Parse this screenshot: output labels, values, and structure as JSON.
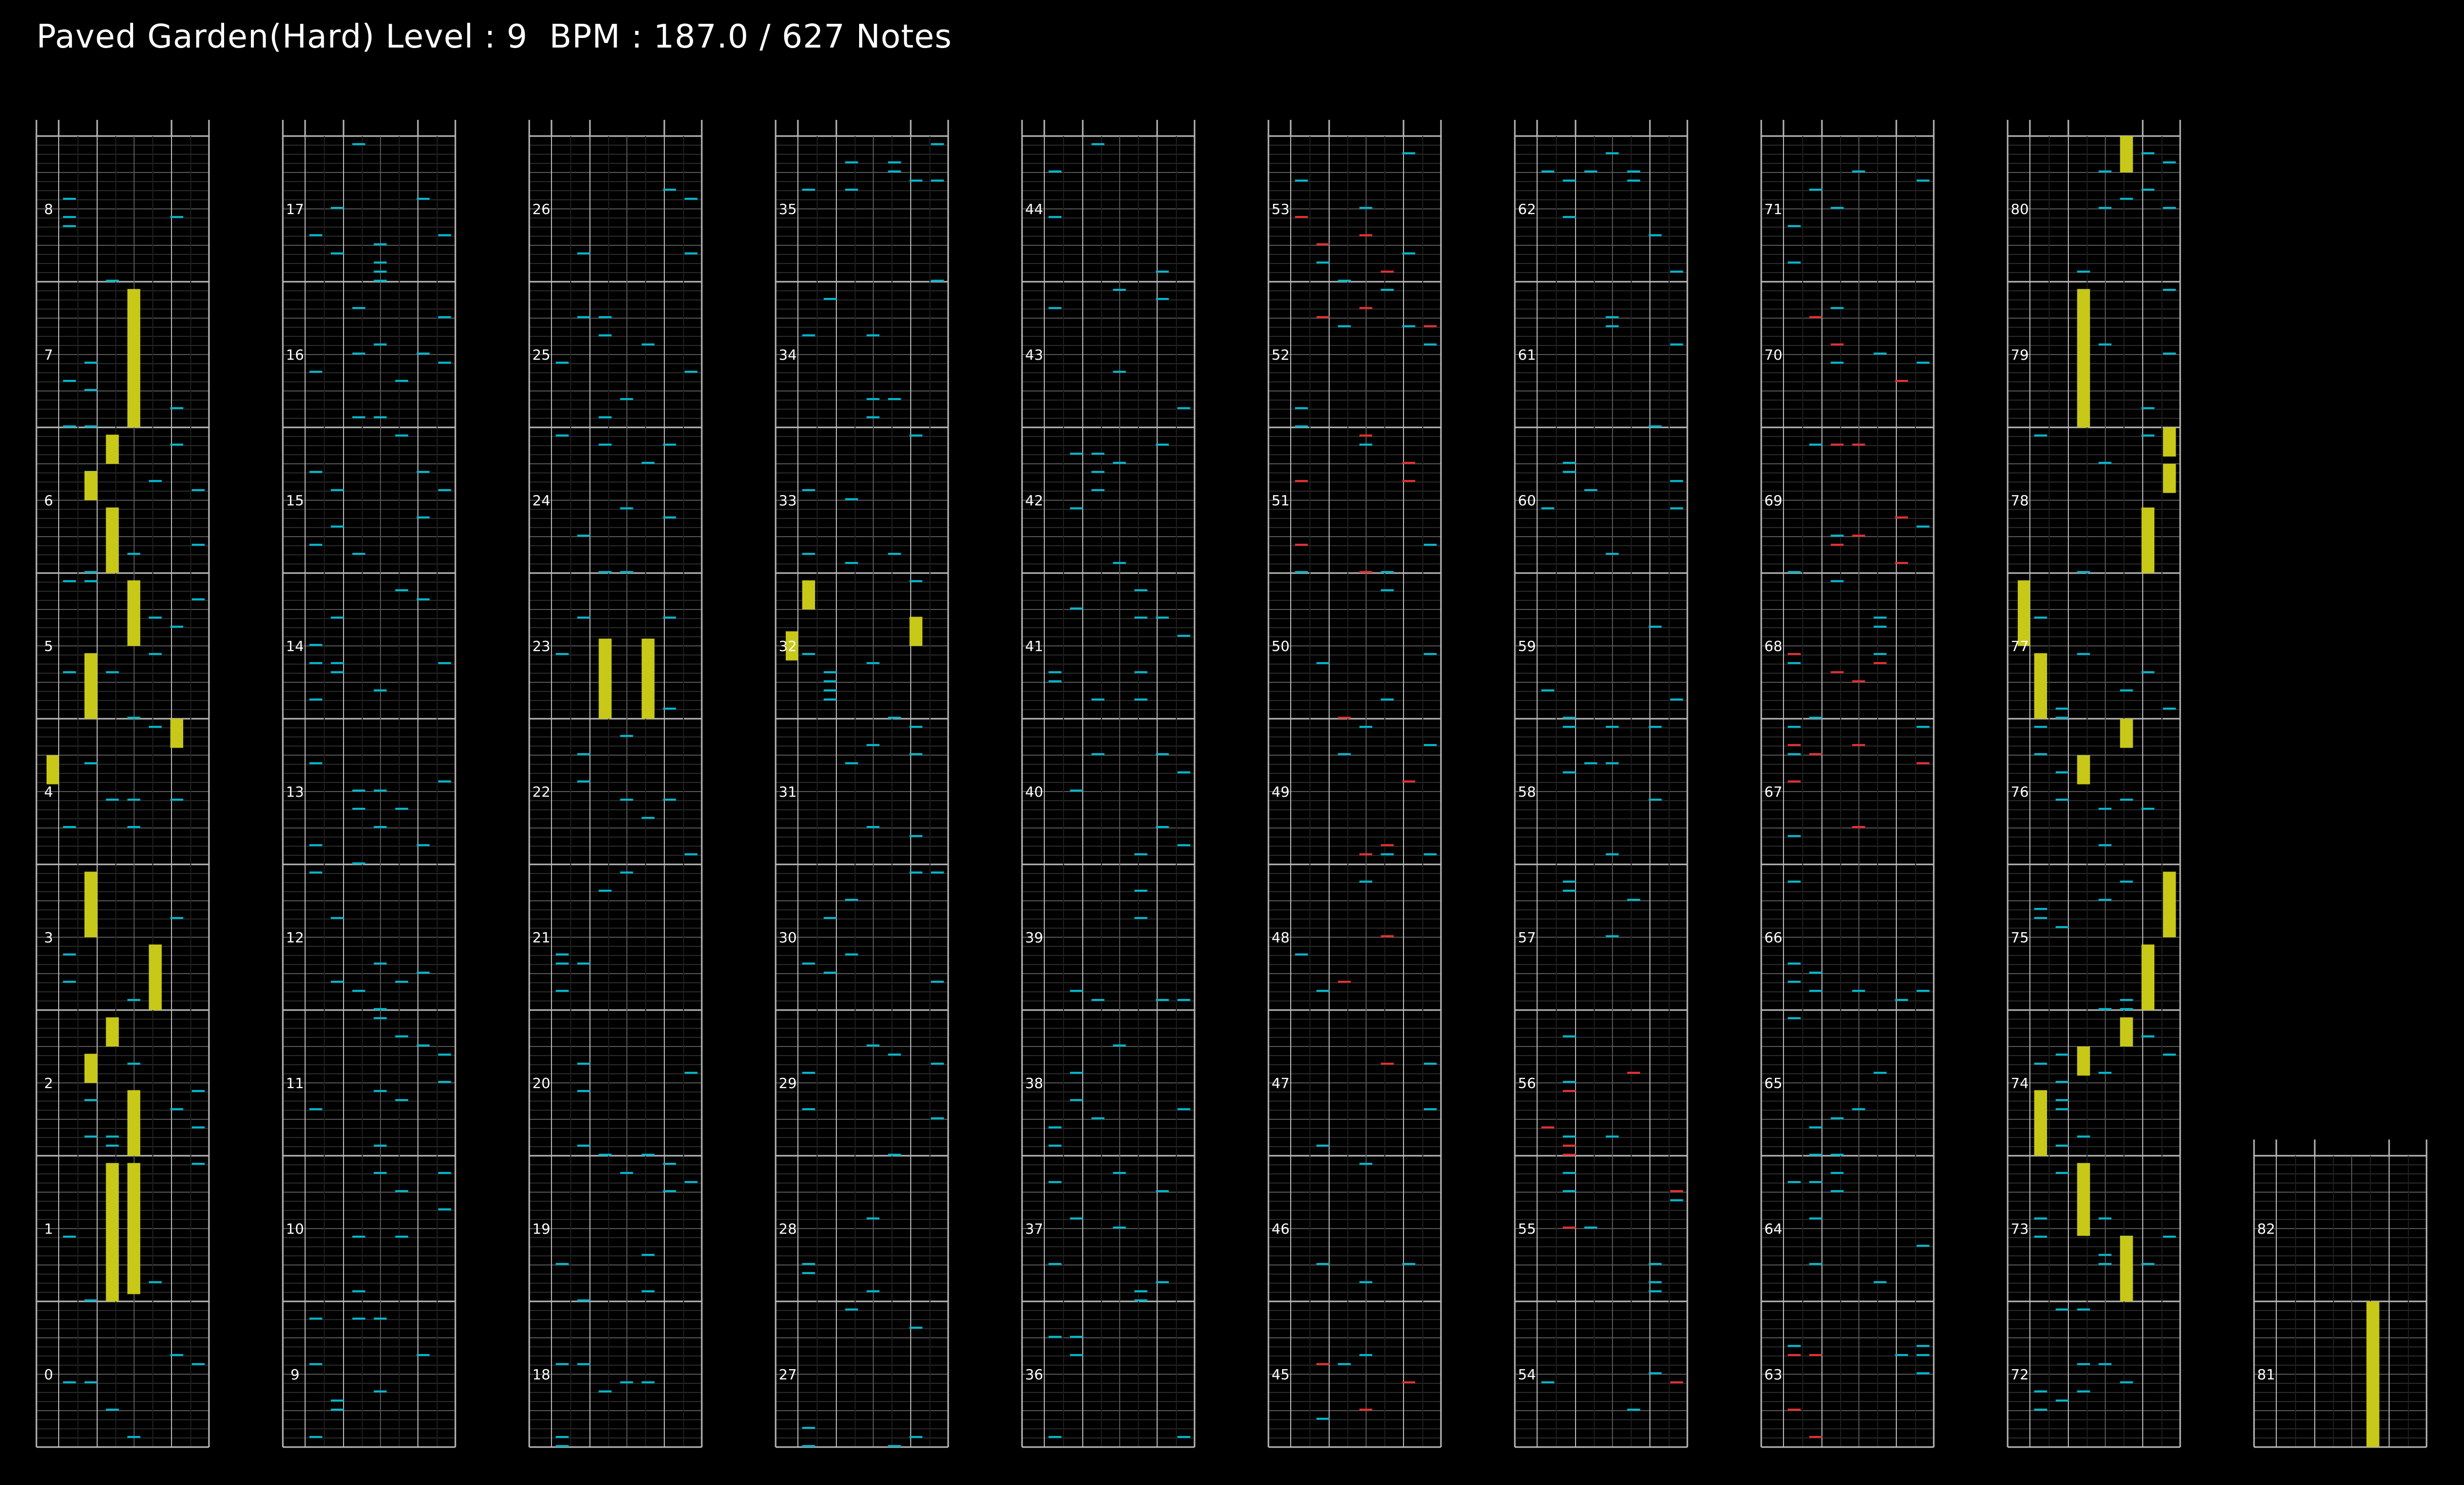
{
  "header": {
    "title": "Paved Garden(Hard) Level : 9  BPM : 187.0 / 627 Notes"
  },
  "chart_data": {
    "type": "rhythm-chart",
    "song": "Paved Garden",
    "difficulty": "Hard",
    "level": 9,
    "bpm": 187.0,
    "notes": 627,
    "measures_per_column": 9,
    "total_measures": 83,
    "lanes": 8,
    "colors": {
      "background": "#000000",
      "measure_line": "#b8b8b8",
      "beat_line": "#555555",
      "grid_line": "#2a2a2a",
      "tap_note": "#00b4c8",
      "alt_note": "#e03030",
      "long_note": "#c8c819",
      "text": "#ffffff"
    },
    "long_notes": [
      {
        "measure": 1,
        "lane": 5,
        "start": 0.05,
        "end": 0.95
      },
      {
        "measure": 1,
        "lane": 4,
        "start": 0.0,
        "end": 0.95
      },
      {
        "measure": 2,
        "lane": 4,
        "start": 0.75,
        "end": 0.95
      },
      {
        "measure": 2,
        "lane": 3,
        "start": 0.5,
        "end": 0.7
      },
      {
        "measure": 2,
        "lane": 5,
        "start": 0.0,
        "end": 0.45
      },
      {
        "measure": 3,
        "lane": 3,
        "start": 0.5,
        "end": 0.95
      },
      {
        "measure": 3,
        "lane": 6,
        "start": 0.0,
        "end": 0.45
      },
      {
        "measure": 4,
        "lane": 1,
        "start": 0.55,
        "end": 0.75
      },
      {
        "measure": 4,
        "lane": 7,
        "start": 0.8,
        "end": 1.0
      },
      {
        "measure": 5,
        "lane": 3,
        "start": 0.0,
        "end": 0.45
      },
      {
        "measure": 5,
        "lane": 5,
        "start": 0.5,
        "end": 0.95
      },
      {
        "measure": 6,
        "lane": 4,
        "start": 0.0,
        "end": 0.45
      },
      {
        "measure": 6,
        "lane": 3,
        "start": 0.5,
        "end": 0.7
      },
      {
        "measure": 6,
        "lane": 4,
        "start": 0.75,
        "end": 0.95
      },
      {
        "measure": 7,
        "lane": 5,
        "start": 0.0,
        "end": 0.95
      },
      {
        "measure": 23,
        "lane": 4,
        "start": 0.0,
        "end": 0.55
      },
      {
        "measure": 23,
        "lane": 6,
        "start": 0.0,
        "end": 0.55
      },
      {
        "measure": 32,
        "lane": 1,
        "start": 0.4,
        "end": 0.6
      },
      {
        "measure": 32,
        "lane": 7,
        "start": 0.5,
        "end": 0.7
      },
      {
        "measure": 32,
        "lane": 2,
        "start": 0.75,
        "end": 0.95
      },
      {
        "measure": 72,
        "lane": 4,
        "start": 0.0,
        "end": 0.0
      },
      {
        "measure": 73,
        "lane": 6,
        "start": 0.0,
        "end": 0.45
      },
      {
        "measure": 73,
        "lane": 4,
        "start": 0.45,
        "end": 0.95
      },
      {
        "measure": 74,
        "lane": 2,
        "start": 0.0,
        "end": 0.45
      },
      {
        "measure": 74,
        "lane": 4,
        "start": 0.55,
        "end": 0.75
      },
      {
        "measure": 74,
        "lane": 6,
        "start": 0.75,
        "end": 0.95
      },
      {
        "measure": 75,
        "lane": 7,
        "start": 0.0,
        "end": 0.45
      },
      {
        "measure": 75,
        "lane": 8,
        "start": 0.5,
        "end": 0.95
      },
      {
        "measure": 76,
        "lane": 4,
        "start": 0.55,
        "end": 0.75
      },
      {
        "measure": 76,
        "lane": 6,
        "start": 0.8,
        "end": 1.0
      },
      {
        "measure": 77,
        "lane": 2,
        "start": 0.0,
        "end": 0.45
      },
      {
        "measure": 77,
        "lane": 1,
        "start": 0.5,
        "end": 0.95
      },
      {
        "measure": 78,
        "lane": 7,
        "start": 0.0,
        "end": 0.45
      },
      {
        "measure": 78,
        "lane": 8,
        "start": 0.55,
        "end": 0.75
      },
      {
        "measure": 78,
        "lane": 8,
        "start": 0.8,
        "end": 1.0
      },
      {
        "measure": 79,
        "lane": 4,
        "start": 0.0,
        "end": 0.95
      },
      {
        "measure": 80,
        "lane": 6,
        "start": 0.75,
        "end": 1.0
      },
      {
        "measure": 81,
        "lane": 6,
        "start": 0.0,
        "end": 1.0
      }
    ],
    "red_sections": [
      {
        "from": 45,
        "to": 53
      },
      {
        "from": 54,
        "to": 56
      },
      {
        "from": 63,
        "to": 63
      },
      {
        "from": 67,
        "to": 70
      }
    ]
  }
}
